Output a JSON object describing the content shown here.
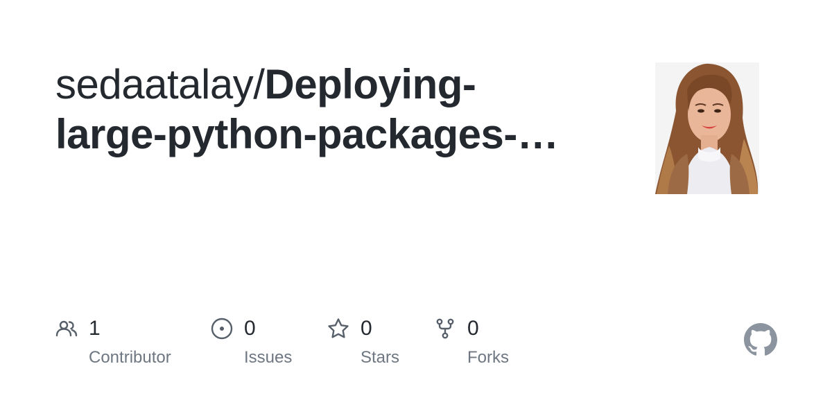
{
  "repo": {
    "owner": "sedaatalay/",
    "name_line1": "Deploying-",
    "name_line2": "large-python-packages-…"
  },
  "stats": {
    "contributors": {
      "value": "1",
      "label": "Contributor",
      "icon": "people-icon"
    },
    "issues": {
      "value": "0",
      "label": "Issues",
      "icon": "issue-opened-icon"
    },
    "stars": {
      "value": "0",
      "label": "Stars",
      "icon": "star-icon"
    },
    "forks": {
      "value": "0",
      "label": "Forks",
      "icon": "repo-forked-icon"
    }
  },
  "colors": {
    "text_primary": "#24292f",
    "text_muted": "#6e7781",
    "icon": "#57606a",
    "github_logo": "#8c959f"
  }
}
